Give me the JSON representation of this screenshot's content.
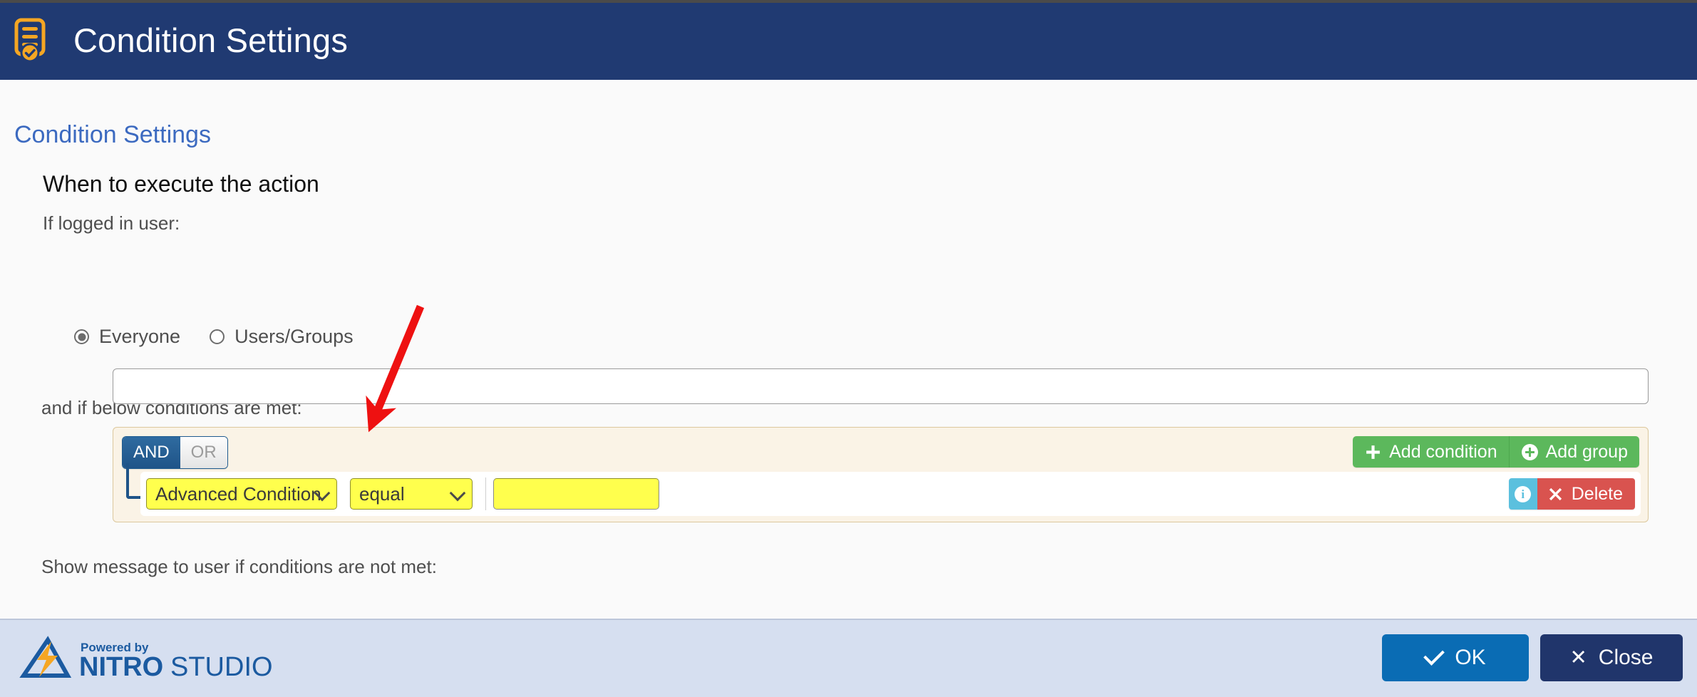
{
  "window": {
    "title": "Condition Settings",
    "icon": "document-check-icon",
    "titlebar_color": "#203a72"
  },
  "breadcrumb": {
    "label": "Condition Settings",
    "color": "#3c6ac0"
  },
  "form": {
    "heading": "When to execute the action",
    "if_logged_in_label": "If logged in user:",
    "radios": [
      {
        "label": "Everyone",
        "checked": true
      },
      {
        "label": "Users/Groups",
        "checked": false
      }
    ],
    "conditions_label": "and if below conditions are met:",
    "show_message_label": "Show message to user if conditions are not met:",
    "message_value": "",
    "message_placeholder": ""
  },
  "query_builder": {
    "logic": {
      "and_label": "AND",
      "or_label": "OR",
      "selected": "AND"
    },
    "actions": [
      {
        "label": "Add condition",
        "icon": "plus-icon",
        "color": "#5cb85c"
      },
      {
        "label": "Add group",
        "icon": "plus-circle-icon",
        "color": "#5cb85c"
      }
    ],
    "rules": [
      {
        "field_value": "Advanced Condition",
        "operator_value": "equal",
        "input_value": "",
        "input_placeholder": "",
        "info_label": "i",
        "delete_label": "Delete",
        "highlight_color": "#ffff4d"
      }
    ]
  },
  "annotation": {
    "type": "arrow",
    "color": "#ee1111",
    "points_to": "field-select"
  },
  "footer": {
    "brand_powered_by": "Powered by",
    "brand_nitro": "NITRO",
    "brand_studio": "STUDIO",
    "buttons": [
      {
        "label": "OK",
        "icon": "check-icon",
        "color": "#0a6cb4"
      },
      {
        "label": "Close",
        "icon": "x-icon",
        "color": "#20356b"
      }
    ]
  }
}
